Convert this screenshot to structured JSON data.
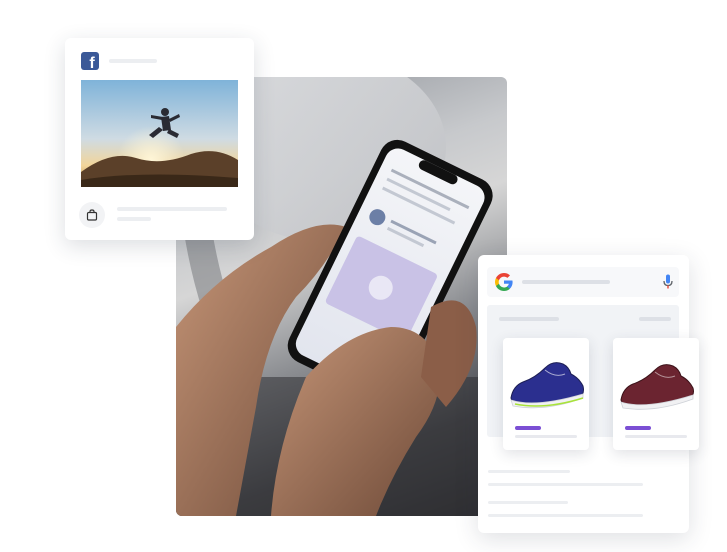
{
  "colors": {
    "facebook": "#3b5998",
    "accent": "#7b4fd4",
    "google_blue": "#4285F4",
    "google_red": "#EA4335",
    "google_yellow": "#FBBC05",
    "google_green": "#34A853"
  },
  "icons": {
    "facebook": "facebook-logo-icon",
    "bag": "shopping-bag-icon",
    "google": "google-logo-icon",
    "mic": "microphone-icon"
  },
  "facebook_card": {
    "logo_letter": "f"
  },
  "google_card": {
    "products": [
      {
        "shoe_color": "#2b2f8f",
        "accent_color": "#1d1f55"
      },
      {
        "shoe_color": "#6b2430",
        "accent_color": "#3c1219"
      }
    ]
  }
}
